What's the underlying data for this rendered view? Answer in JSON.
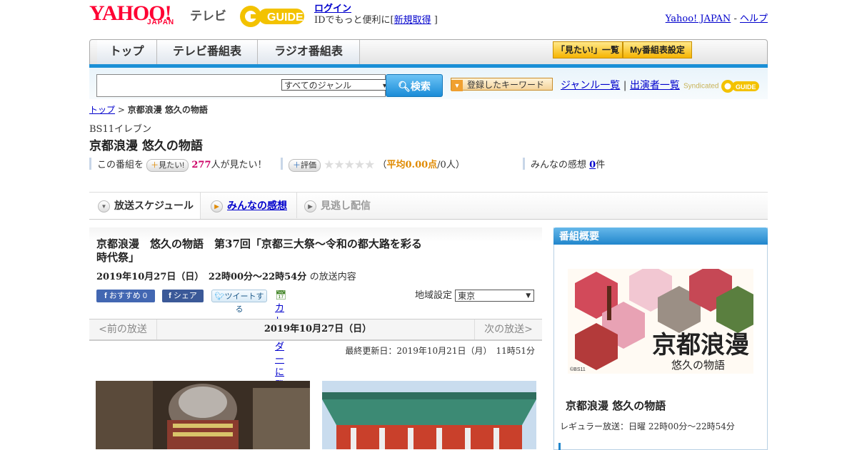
{
  "header": {
    "brand_main": "YAHOO!",
    "brand_sub": "JAPAN",
    "brand_tv": "テレビ",
    "gguide_logo": "G-GUIDE",
    "login_link": "ログイン",
    "login_text_before": "IDでもっと便利に[",
    "signup_link": "新規取得",
    "login_text_after": "]",
    "yahoo_japan_link": "Yahoo! JAPAN",
    "separator": "-",
    "help_link": "ヘルプ"
  },
  "nav": {
    "tabs": [
      "トップ",
      "テレビ番組表",
      "ラジオ番組表"
    ],
    "mitai_list": "「見たい!」一覧",
    "my_program": "My番組表設定"
  },
  "search": {
    "genre_value": "すべてのジャンル",
    "search_button": "検索",
    "keyword_button": "登録したキーワード",
    "genre_list_link": "ジャンル一覧",
    "links_separator": "|",
    "performer_list_link": "出演者一覧",
    "syndicated": "Syndicated"
  },
  "breadcrumb": {
    "top": "トップ",
    "sep": ">",
    "current": "京都浪漫 悠久の物語"
  },
  "program": {
    "channel": "BS11イレブン",
    "title": "京都浪漫 悠久の物語"
  },
  "ratings": {
    "prefix": "この番組を",
    "mitai_button": "見たい!",
    "mitai_count": "277",
    "mitai_suffix": "人が見たい！",
    "rate_button": "評価",
    "stars": "★★★★★",
    "avg_open": "（",
    "avg_value": "平均0.00点",
    "avg_people": "/0人）",
    "impressions_label": "みんなの感想",
    "impressions_count": "0",
    "impressions_suffix": "件"
  },
  "tabs": {
    "schedule": "放送スケジュール",
    "impressions": "みんなの感想",
    "missed": "見逃し配信"
  },
  "episode": {
    "title": "京都浪漫　悠久の物語　第37回「京都三大祭～令和の都大路を彩る時代祭」",
    "date_time": "2019年10月27日（日）　22時00分～22時54分",
    "date_suffix": "の放送内容",
    "fb_recommend": "おすすめ 0",
    "fb_share": "シェア",
    "tweet": "ツイートする",
    "calendar": "カレンダーに登録",
    "region_label": "地域設定",
    "region_value": "東京",
    "prev": "<前の放送",
    "current_date": "2019年10月27日（日）",
    "next": "次の放送>",
    "updated": "最終更新日：2019年10月21日（月）　11時51分"
  },
  "sidebar": {
    "heading": "番組概要",
    "image_title_main": "京都浪漫",
    "image_title_sub": "悠久の物語",
    "image_credit": "©BS11",
    "program_title": "京都浪漫 悠久の物語",
    "regular": "レギュラー放送：日曜 22時00分～22時54分"
  },
  "colors": {
    "accent_blue": "#1b8fd6",
    "brand_red": "#ff0033",
    "gold": "#f6b400"
  }
}
